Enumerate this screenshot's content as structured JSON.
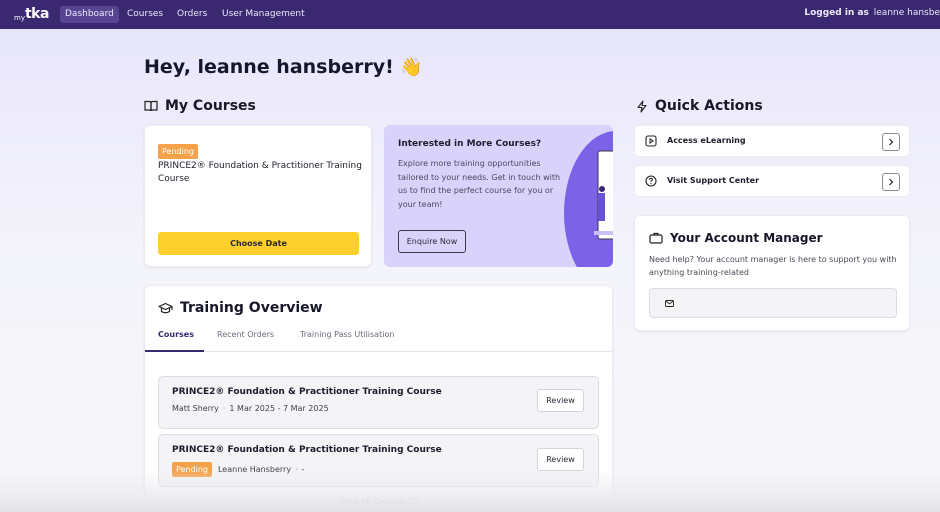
{
  "nav": {
    "logo_my": "my",
    "logo_tka": "tka",
    "items": [
      {
        "label": "Dashboard",
        "active": true
      },
      {
        "label": "Courses",
        "active": false
      },
      {
        "label": "Orders",
        "active": false
      },
      {
        "label": "User Management",
        "active": false
      }
    ],
    "logged_prefix": "Logged in as",
    "logged_user": "leanne hansbe"
  },
  "greeting": "Hey, leanne hansberry!",
  "greeting_emoji": "👋",
  "my_courses": {
    "title": "My Courses",
    "pending_card": {
      "badge": "Pending",
      "course": "PRINCE2® Foundation & Practitioner Training Course",
      "button": "Choose Date"
    },
    "promo": {
      "title": "Interested in More Courses?",
      "text": "Explore more training opportunities tailored to your needs. Get in touch with us to find the perfect course for you or your team!",
      "button": "Enquire Now"
    }
  },
  "training_overview": {
    "title": "Training Overview",
    "tabs": [
      {
        "label": "Courses",
        "active": true
      },
      {
        "label": "Recent Orders",
        "active": false
      },
      {
        "label": "Training Pass Utilisation",
        "active": false
      }
    ],
    "rows": [
      {
        "course": "PRINCE2® Foundation & Practitioner Training Course",
        "person": "Matt Sherry",
        "dates": "1 Mar 2025 - 7 Mar 2025",
        "button": "Review"
      },
      {
        "course": "PRINCE2® Foundation & Practitioner Training Course",
        "badge": "Pending",
        "person": "Leanne Hansberry",
        "dates": "-",
        "button": "Review"
      }
    ],
    "view_all": "View All Courses (2)"
  },
  "quick_actions": {
    "title": "Quick Actions",
    "items": [
      {
        "label": "Access eLearning",
        "icon": "play-square-icon"
      },
      {
        "label": "Visit Support Center",
        "icon": "help-circle-icon"
      }
    ]
  },
  "account_manager": {
    "title": "Your Account Manager",
    "text": "Need help? Your account manager is here to support you with anything training-related",
    "email_icon": "mail-icon"
  },
  "colors": {
    "nav_bg": "#3a2870",
    "accent_yellow": "#fdd02c",
    "pending_orange": "#f6a24a",
    "promo_bg": "#d9d3fb"
  }
}
